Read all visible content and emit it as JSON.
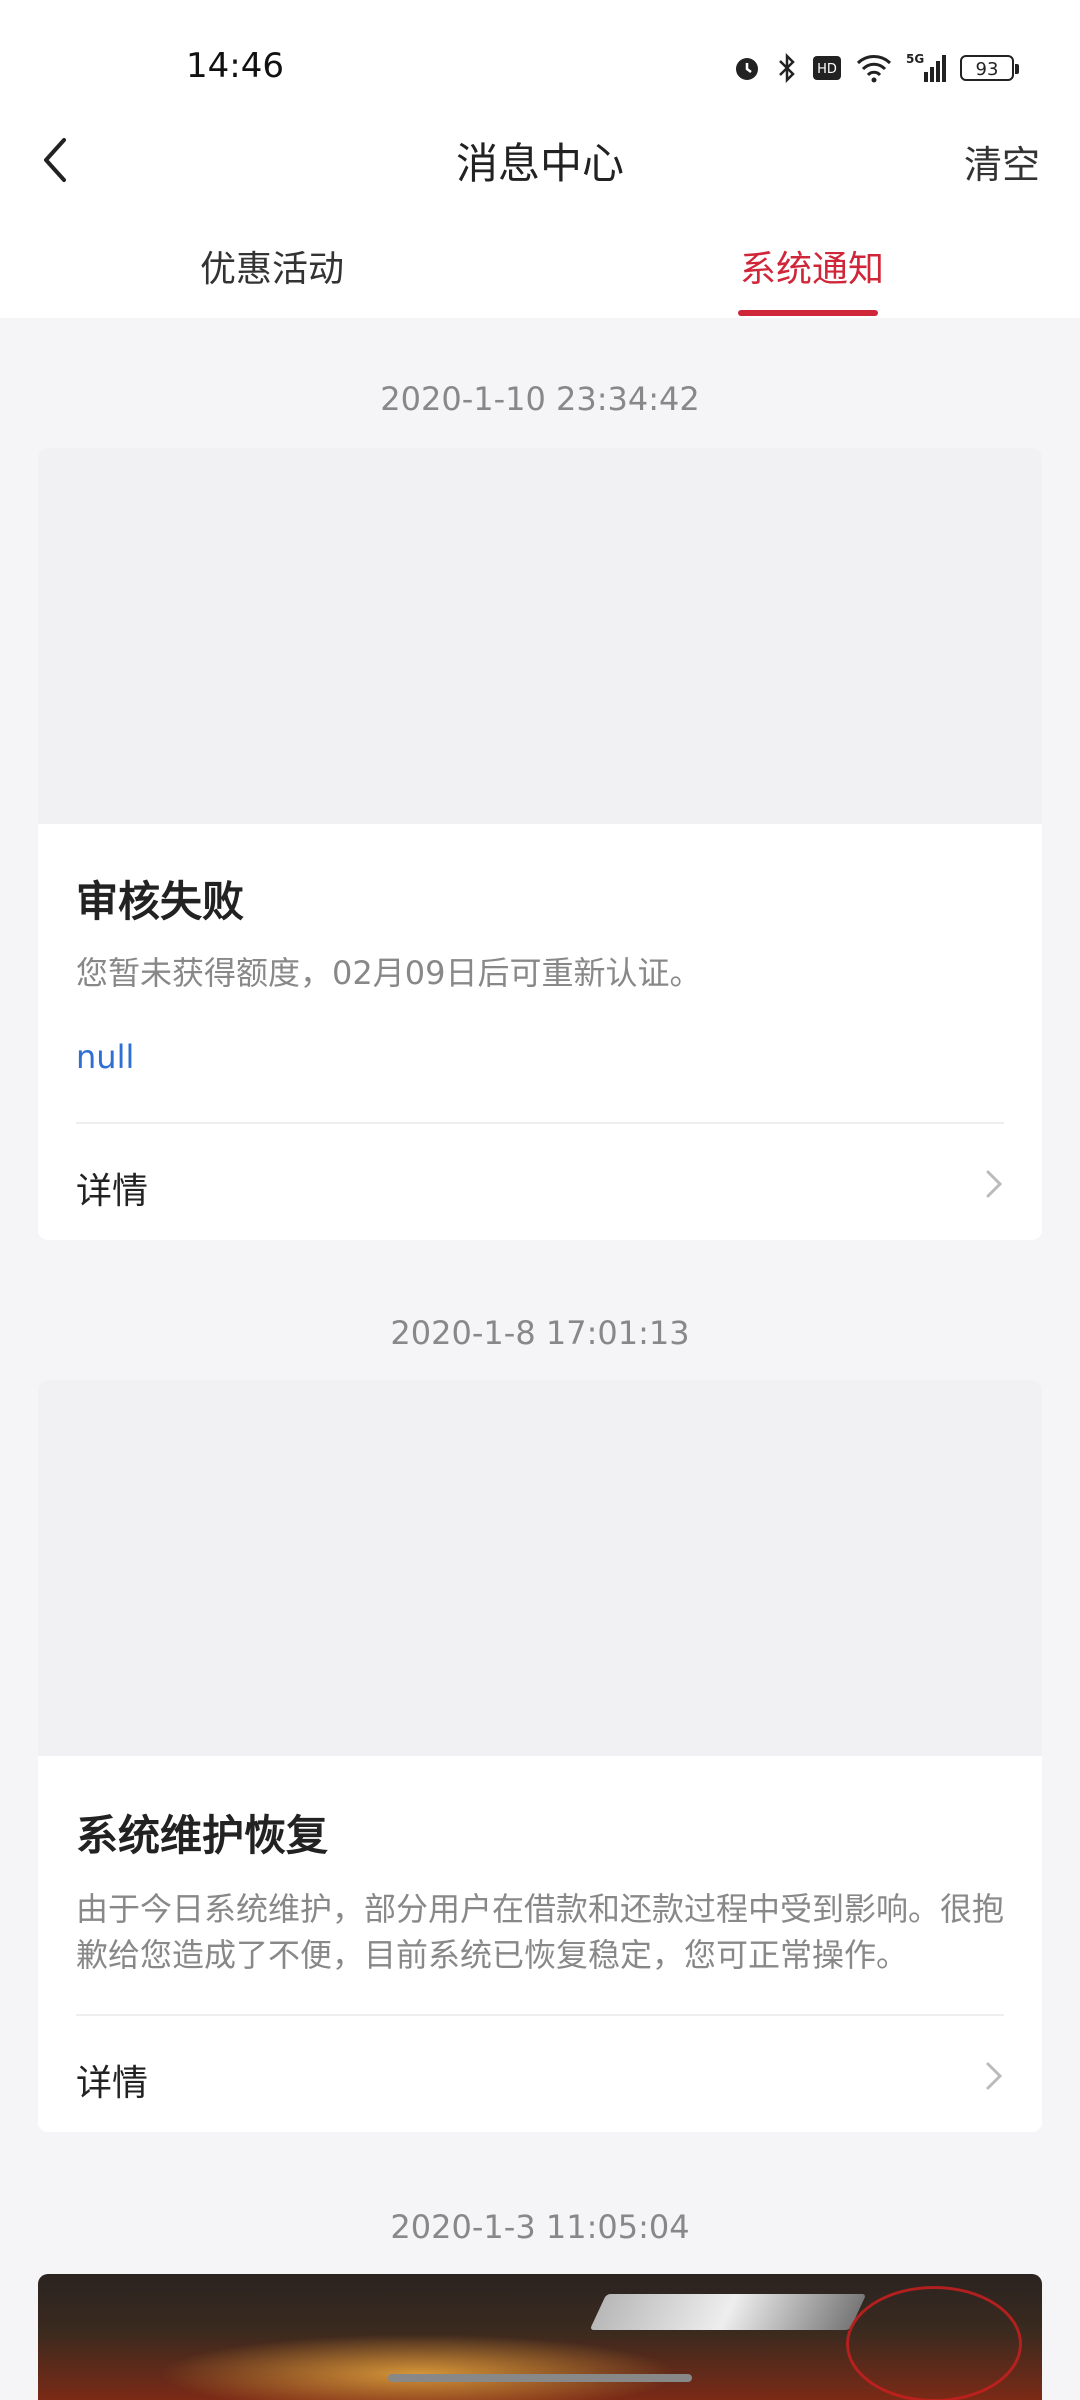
{
  "status_bar": {
    "time": "14:46",
    "network": "5G",
    "battery": "93"
  },
  "header": {
    "title": "消息中心",
    "clear_label": "清空"
  },
  "tabs": [
    {
      "label": "优惠活动",
      "active": false
    },
    {
      "label": "系统通知",
      "active": true
    }
  ],
  "accent_color": "#d0263a",
  "messages": [
    {
      "timestamp": "2020-1-10 23:34:42",
      "title": "审核失败",
      "body": "您暂未获得额度，02月09日后可重新认证。",
      "link": "null",
      "details_label": "详情"
    },
    {
      "timestamp": "2020-1-8 17:01:13",
      "title": "系统维护恢复",
      "body": "由于今日系统维护，部分用户在借款和还款过程中受到影响。很抱歉给您造成了不便，目前系统已恢复稳定，您可正常操作。",
      "details_label": "详情"
    },
    {
      "timestamp": "2020-1-3 11:05:04"
    }
  ]
}
